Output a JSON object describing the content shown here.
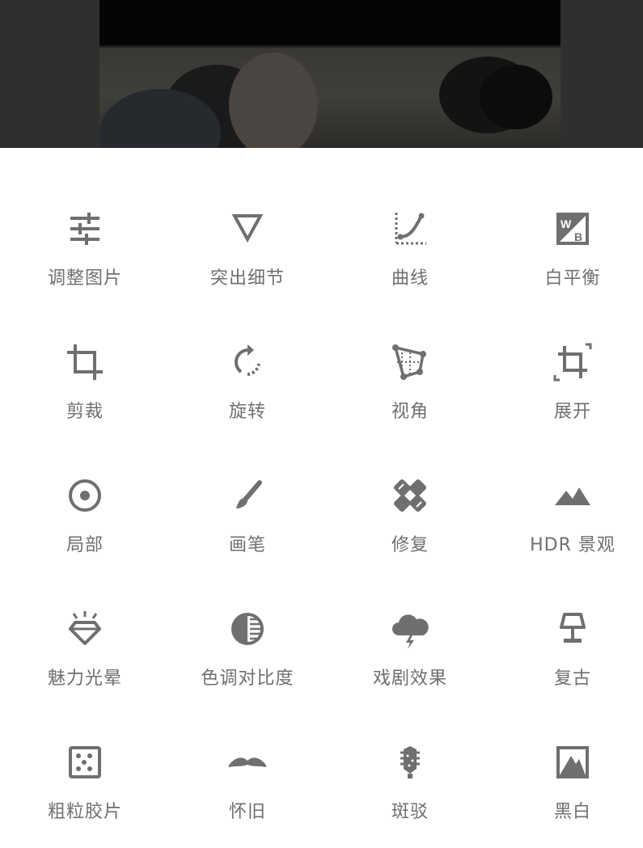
{
  "colors": {
    "icon": "#6f6f6f",
    "label": "#6f6f6f",
    "background": "#ffffff",
    "preview_bg": "#2f2f2f"
  },
  "tools": [
    {
      "label": "调整图片",
      "icon": "sliders-icon"
    },
    {
      "label": "突出细节",
      "icon": "triangle-down-icon"
    },
    {
      "label": "曲线",
      "icon": "curves-icon"
    },
    {
      "label": "白平衡",
      "icon": "white-balance-icon"
    },
    {
      "label": "剪裁",
      "icon": "crop-icon"
    },
    {
      "label": "旋转",
      "icon": "rotate-icon"
    },
    {
      "label": "视角",
      "icon": "perspective-icon"
    },
    {
      "label": "展开",
      "icon": "expand-icon"
    },
    {
      "label": "局部",
      "icon": "target-icon"
    },
    {
      "label": "画笔",
      "icon": "brush-icon"
    },
    {
      "label": "修复",
      "icon": "bandage-icon"
    },
    {
      "label": "HDR 景观",
      "icon": "mountains-icon"
    },
    {
      "label": "魅力光晕",
      "icon": "diamond-glow-icon"
    },
    {
      "label": "色调对比度",
      "icon": "contrast-icon"
    },
    {
      "label": "戏剧效果",
      "icon": "storm-cloud-icon"
    },
    {
      "label": "复古",
      "icon": "lamp-icon"
    },
    {
      "label": "粗粒胶片",
      "icon": "film-grain-icon"
    },
    {
      "label": "怀旧",
      "icon": "mustache-icon"
    },
    {
      "label": "斑驳",
      "icon": "guitar-icon"
    },
    {
      "label": "黑白",
      "icon": "black-white-icon"
    }
  ]
}
